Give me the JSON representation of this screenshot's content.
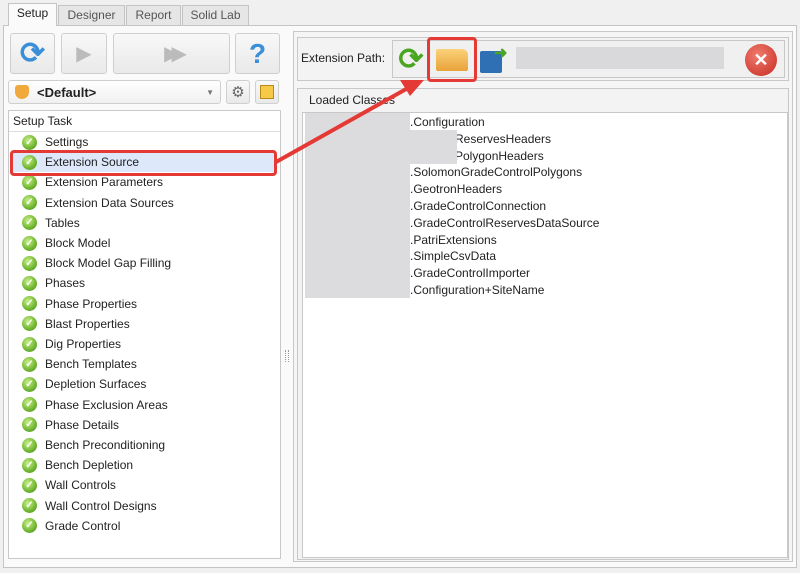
{
  "tabs": [
    {
      "label": "Setup"
    },
    {
      "label": "Designer"
    },
    {
      "label": "Report"
    },
    {
      "label": "Solid Lab"
    }
  ],
  "profile": {
    "selected": "<Default>"
  },
  "setup_task": {
    "header": "Setup Task",
    "selected_index": 1,
    "items": [
      "Settings",
      "Extension Source",
      "Extension Parameters",
      "Extension Data Sources",
      "Tables",
      "Block Model",
      "Block Model Gap Filling",
      "Phases",
      "Phase Properties",
      "Blast Properties",
      "Dig Properties",
      "Bench Templates",
      "Depletion Surfaces",
      "Phase Exclusion Areas",
      "Phase Details",
      "Bench Preconditioning",
      "Bench Depletion",
      "Wall Controls",
      "Wall Control Designs",
      "Grade Control"
    ]
  },
  "extension": {
    "label": "Extension Path:",
    "path": ""
  },
  "loaded_classes": {
    "header": "Loaded Classes",
    "items": [
      ".Configuration",
      "ReservesHeaders",
      "PolygonHeaders",
      ".SolomonGradeControlPolygons",
      ".GeotronHeaders",
      ".GradeControlConnection",
      ".GradeControlReservesDataSource",
      ".PatriExtensions",
      ".SimpleCsvData",
      ".GradeControlImporter",
      ".Configuration+SiteName"
    ]
  },
  "colors": {
    "highlight": "#e53935",
    "selection": "#dde8fb"
  }
}
